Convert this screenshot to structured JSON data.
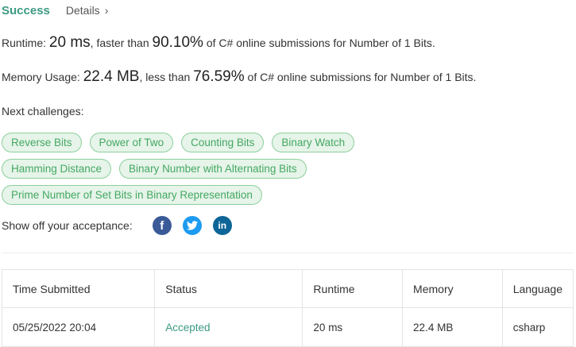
{
  "header": {
    "status": "Success",
    "details_label": "Details",
    "details_chevron": "›"
  },
  "runtime": {
    "label": "Runtime:",
    "value": "20 ms",
    "comparison": ", faster than",
    "percent": "90.10%",
    "suffix": "of C# online submissions for Number of 1 Bits."
  },
  "memory": {
    "label": "Memory Usage:",
    "value": "22.4 MB",
    "comparison": ", less than",
    "percent": "76.59%",
    "suffix": "of C# online submissions for Number of 1 Bits."
  },
  "challenges": {
    "label": "Next challenges:",
    "rows": [
      [
        "Reverse Bits",
        "Power of Two",
        "Counting Bits",
        "Binary Watch"
      ],
      [
        "Hamming Distance",
        "Binary Number with Alternating Bits"
      ],
      [
        "Prime Number of Set Bits in Binary Representation"
      ]
    ]
  },
  "share": {
    "label": "Show off your acceptance:",
    "icons": [
      "facebook-icon",
      "twitter-icon",
      "linkedin-icon"
    ],
    "facebook_glyph": "f",
    "linkedin_glyph": "in"
  },
  "colors": {
    "success": "#3c9a82",
    "chip_bg": "#e6f4e9",
    "chip_border": "#8bcf9c",
    "chip_text": "#44a862",
    "facebook": "#3a5a98",
    "twitter": "#1d9bf0",
    "linkedin": "#0e6597"
  },
  "table": {
    "headers": [
      "Time Submitted",
      "Status",
      "Runtime",
      "Memory",
      "Language"
    ],
    "rows": [
      [
        "05/25/2022 20:04",
        "Accepted",
        "20 ms",
        "22.4 MB",
        "csharp"
      ]
    ]
  }
}
